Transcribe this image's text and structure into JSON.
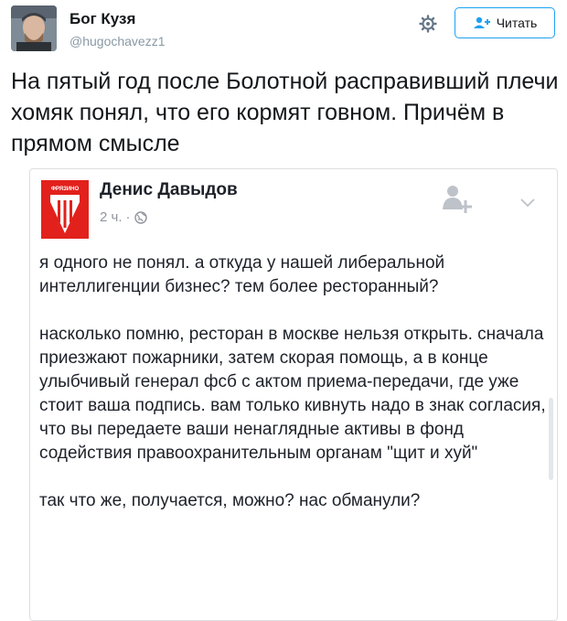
{
  "tweet": {
    "author_name": "Бог Кузя",
    "author_handle": "@hugochavezz1",
    "follow_label": "Читать",
    "text": "На пятый год после Болотной расправивший плечи хомяк понял, что его кормят говном. Причём в прямом смысле"
  },
  "embedded_post": {
    "logo_text": "ФРЯЗИНО",
    "author_name": "Денис Давыдов",
    "time": "2 ч.",
    "separator": "·",
    "paragraphs": [
      "я одного не понял. а откуда у нашей либеральной интеллигенции бизнес? тем более ресторанный?",
      "насколько помню, ресторан в москве нельзя открыть. сначала приезжают пожарники, затем скорая помощь, а в конце улыбчивый генерал фсб с актом приема-передачи, где уже стоит ваша подпись. вам только кивнуть надо в знак согласия, что вы передаете ваши ненаглядные активы в фонд содействия правоохранительным органам \"щит и хуй\"",
      "так что же, получается, можно? нас обманули?"
    ]
  },
  "colors": {
    "accent": "#1da1f2",
    "logo_red": "#e2211c",
    "text": "#14171a",
    "muted": "#8899a6"
  }
}
